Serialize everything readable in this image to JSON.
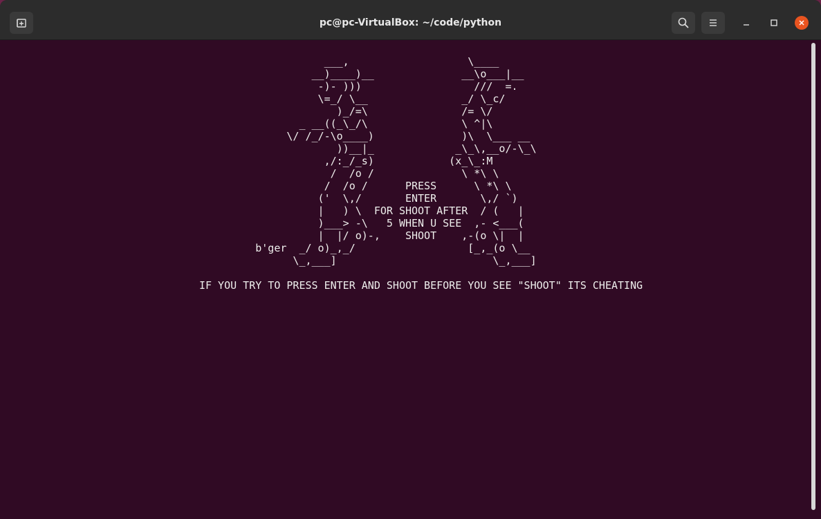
{
  "window": {
    "title": "pc@pc-VirtualBox: ~/code/python"
  },
  "toolbar": {
    "new_tab_icon": "new-tab-icon",
    "search_icon": "search-icon",
    "menu_icon": "hamburger-menu-icon",
    "minimize_icon": "minimize-icon",
    "maximize_icon": "maximize-icon",
    "close_icon": "close-icon"
  },
  "colors": {
    "terminal_bg": "#300a24",
    "titlebar_bg": "#2c2c2c",
    "text": "#eeeeec",
    "close_button": "#e95420"
  },
  "terminal": {
    "lines": [
      "                                                   ___,                   \\____",
      "                                                 __)____)__              __\\o___|__",
      "                                                  -)- )))                  ///  =.",
      "                                                  \\=_/ \\__               _/ \\_c/",
      "                                                     )_/=\\               /= \\/",
      "                                               _ __((_\\_/\\               \\ ^|\\",
      "                                             \\/ /_/-\\o____)              )\\  \\___ __",
      "                                                     ))__|_             _\\_\\,__o/-\\_\\",
      "                                                   ,/:_/_s)            (x_\\_:M",
      "                                                    /  /o /              \\ *\\ \\",
      "                                                   /  /o /      PRESS      \\ *\\ \\",
      "                                                  ('  \\,/       ENTER       \\,/ `)",
      "                                                  |   ) \\  FOR SHOOT AFTER  / (   |",
      "                                                  )___> -\\   5 WHEN U SEE  ,- <___(",
      "                                                  |  |/ o)-,    SHOOT    ,-(o \\|  |",
      "                                        b'ger  _/ o)_,_/                  [_,_(o \\__",
      "                                              \\_,___]                         \\_,___]",
      "",
      "                               IF YOU TRY TO PRESS ENTER AND SHOOT BEFORE YOU SEE \"SHOOT\" ITS CHEATING"
    ]
  }
}
